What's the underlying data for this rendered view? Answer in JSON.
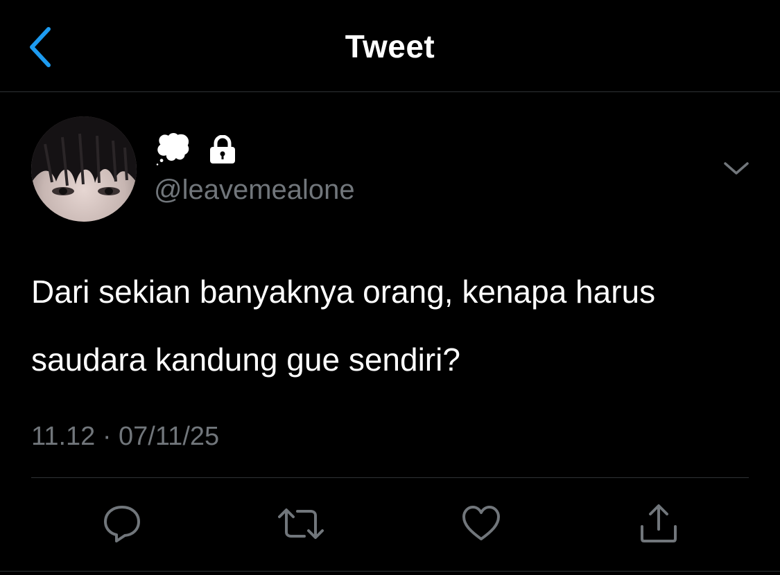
{
  "header": {
    "title": "Tweet",
    "back_icon": "chevron-left-icon",
    "accent_color": "#1d9bf0"
  },
  "tweet": {
    "display_name": "💭",
    "protected_icon": "lock-icon",
    "handle": "@leavemealone",
    "text": "Dari sekian banyaknya orang, kenapa harus saudara kandung gue sendiri?",
    "timestamp": "11.12 · 07/11/25",
    "more_icon": "chevron-down-icon"
  },
  "actions": [
    {
      "icon": "reply-icon"
    },
    {
      "icon": "retweet-icon"
    },
    {
      "icon": "like-icon"
    },
    {
      "icon": "share-icon"
    }
  ],
  "colors": {
    "background": "#000000",
    "text": "#ffffff",
    "secondary_text": "#71767b",
    "divider": "#2f3336"
  }
}
